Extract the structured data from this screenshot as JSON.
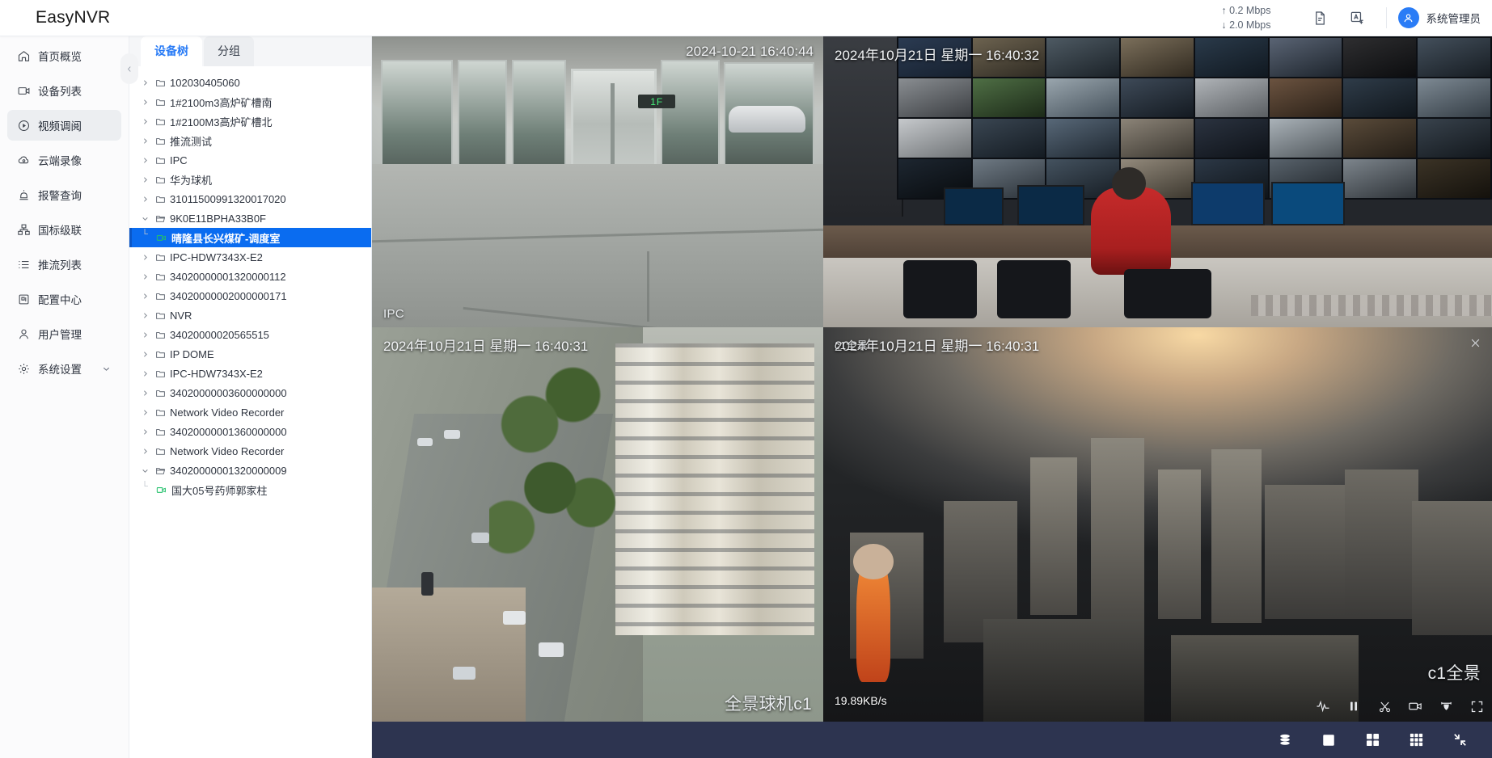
{
  "header": {
    "brand": "EasyNVR",
    "upload_rate": "↑ 0.2 Mbps",
    "download_rate": "↓ 2.0 Mbps",
    "doc_icon": "document-icon",
    "lang_icon": "language-switch-icon",
    "user_name": "系统管理员"
  },
  "nav": {
    "items": [
      {
        "label": "首页概览",
        "icon": "home-icon",
        "active": false
      },
      {
        "label": "设备列表",
        "icon": "device-camera-icon",
        "active": false
      },
      {
        "label": "视频调阅",
        "icon": "play-circle-icon",
        "active": true
      },
      {
        "label": "云端录像",
        "icon": "cloud-record-icon",
        "active": false
      },
      {
        "label": "报警查询",
        "icon": "alarm-icon",
        "active": false
      },
      {
        "label": "国标级联",
        "icon": "cascade-icon",
        "active": false
      },
      {
        "label": "推流列表",
        "icon": "list-icon",
        "active": false
      },
      {
        "label": "配置中心",
        "icon": "config-icon",
        "active": false
      },
      {
        "label": "用户管理",
        "icon": "user-icon",
        "active": false
      },
      {
        "label": "系统设置",
        "icon": "gear-icon",
        "active": false,
        "caret": "chevron-down-icon"
      }
    ]
  },
  "tree_panel": {
    "collapse_icon": "chevron-left-icon",
    "tabs": [
      {
        "label": "设备树",
        "active": true
      },
      {
        "label": "分组",
        "active": false
      }
    ],
    "nodes": [
      {
        "label": "102030405060",
        "type": "folder",
        "expanded": false,
        "selected": false,
        "depth": 0
      },
      {
        "label": "1#2100m3高炉矿槽南",
        "type": "folder",
        "expanded": false,
        "selected": false,
        "depth": 0
      },
      {
        "label": "1#2100M3高炉矿槽北",
        "type": "folder",
        "expanded": false,
        "selected": false,
        "depth": 0
      },
      {
        "label": "推流测试",
        "type": "folder",
        "expanded": false,
        "selected": false,
        "depth": 0
      },
      {
        "label": "IPC",
        "type": "folder",
        "expanded": false,
        "selected": false,
        "depth": 0
      },
      {
        "label": "华为球机",
        "type": "folder",
        "expanded": false,
        "selected": false,
        "depth": 0
      },
      {
        "label": "31011500991320017020",
        "type": "folder",
        "expanded": false,
        "selected": false,
        "depth": 0
      },
      {
        "label": "9K0E11BPHA33B0F",
        "type": "folder",
        "expanded": true,
        "selected": false,
        "depth": 0
      },
      {
        "label": "晴隆县长兴煤矿-调度室",
        "type": "camera",
        "expanded": false,
        "selected": true,
        "depth": 1
      },
      {
        "label": "IPC-HDW7343X-E2",
        "type": "folder",
        "expanded": false,
        "selected": false,
        "depth": 0
      },
      {
        "label": "34020000001320000112",
        "type": "folder",
        "expanded": false,
        "selected": false,
        "depth": 0
      },
      {
        "label": "34020000002000000171",
        "type": "folder",
        "expanded": false,
        "selected": false,
        "depth": 0
      },
      {
        "label": "NVR",
        "type": "folder",
        "expanded": false,
        "selected": false,
        "depth": 0
      },
      {
        "label": "34020000020565515",
        "type": "folder",
        "expanded": false,
        "selected": false,
        "depth": 0
      },
      {
        "label": "IP DOME",
        "type": "folder",
        "expanded": false,
        "selected": false,
        "depth": 0
      },
      {
        "label": "IPC-HDW7343X-E2",
        "type": "folder",
        "expanded": false,
        "selected": false,
        "depth": 0
      },
      {
        "label": "34020000003600000000",
        "type": "folder",
        "expanded": false,
        "selected": false,
        "depth": 0
      },
      {
        "label": "Network Video Recorder",
        "type": "folder",
        "expanded": false,
        "selected": false,
        "depth": 0
      },
      {
        "label": "34020000001360000000",
        "type": "folder",
        "expanded": false,
        "selected": false,
        "depth": 0
      },
      {
        "label": "Network Video Recorder",
        "type": "folder",
        "expanded": false,
        "selected": false,
        "depth": 0
      },
      {
        "label": "34020000001320000009",
        "type": "folder",
        "expanded": true,
        "selected": false,
        "depth": 0
      },
      {
        "label": "国大05号药师郭家柱",
        "type": "camera",
        "expanded": false,
        "selected": false,
        "depth": 1
      }
    ]
  },
  "video": {
    "cells": [
      {
        "id": "cell-1",
        "osd_time": "2024-10-21 16:40:44",
        "label": "IPC",
        "active": true,
        "scene": "lobby-entrance"
      },
      {
        "id": "cell-2",
        "osd_time": "2024年10月21日  星期一  16:40:32",
        "label": "",
        "active": false,
        "scene": "control-room-video-wall"
      },
      {
        "id": "cell-3",
        "osd_time": "2024年10月21日  星期一  16:40:31",
        "label": "全景球机c1",
        "active": false,
        "scene": "street-aerial"
      },
      {
        "id": "cell-4",
        "osd_time": "2024年10月21日 星期一 16:40:31",
        "label": "c1全景",
        "corner_label": "c1全景",
        "bitrate": "19.89KB/s",
        "active": false,
        "scene": "city-sunset-aerial"
      }
    ],
    "cell4_tools": [
      {
        "name": "waveform-audio-icon"
      },
      {
        "name": "pause-icon"
      },
      {
        "name": "scissors-snapshot-icon"
      },
      {
        "name": "record-video-icon"
      },
      {
        "name": "ptz-control-icon"
      },
      {
        "name": "fullscreen-icon"
      }
    ],
    "cell4_close_icon": "close-icon",
    "toolbar": [
      {
        "name": "stream-stack-icon"
      },
      {
        "name": "layout-1x1-icon"
      },
      {
        "name": "layout-2x2-icon"
      },
      {
        "name": "layout-3x3-icon"
      },
      {
        "name": "exit-fullscreen-icon"
      }
    ]
  }
}
